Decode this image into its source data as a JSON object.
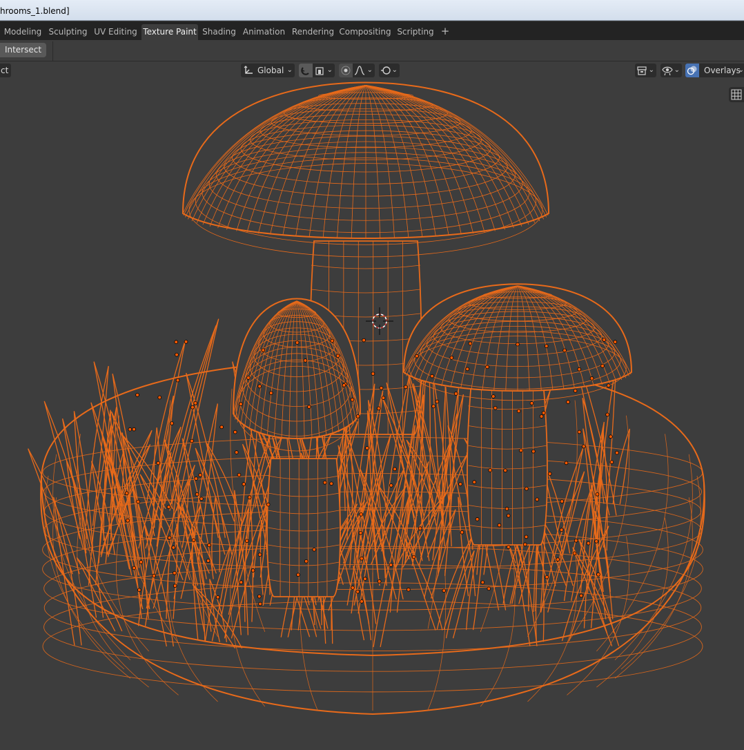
{
  "window": {
    "title": "hrooms_1.blend]"
  },
  "workspace_tabs": [
    {
      "label": "Modeling",
      "active": false
    },
    {
      "label": "Sculpting",
      "active": false
    },
    {
      "label": "UV Editing",
      "active": false
    },
    {
      "label": "Texture Paint",
      "active": true
    },
    {
      "label": "Shading",
      "active": false
    },
    {
      "label": "Animation",
      "active": false
    },
    {
      "label": "Rendering",
      "active": false
    },
    {
      "label": "Compositing",
      "active": false
    },
    {
      "label": "Scripting",
      "active": false
    }
  ],
  "tool_header": {
    "intersect_label": "Intersect"
  },
  "viewport_header": {
    "left_fragment": "ct",
    "transform_orientation": "Global",
    "overlays_label": "Overlays"
  },
  "icons": {
    "add_workspace": "plus-icon",
    "orientation": "transform-axes-icon",
    "snap": "snap-magnet-icon",
    "pivot": "pivot-icon",
    "proportional": "proportional-edit-icon",
    "falloff": "falloff-curve-icon",
    "gizmo": "gizmo-icon",
    "object_type": "object-types-icon",
    "visibility": "eye-visibility-icon",
    "overlays": "overlays-icon",
    "grid_view": "grid-icon"
  },
  "colors": {
    "wire": "#e86a1a",
    "background": "#3d3d3d",
    "selected_vertex": "#ff5a00"
  }
}
